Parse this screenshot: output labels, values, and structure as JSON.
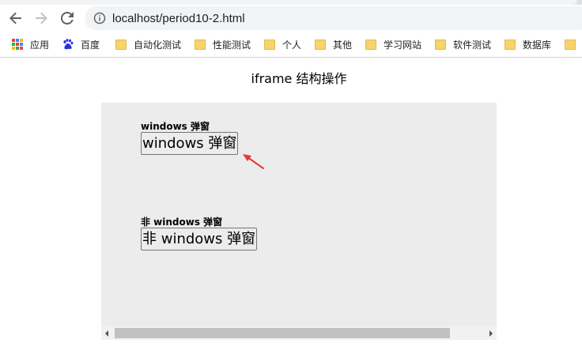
{
  "browser": {
    "url": "localhost/period10-2.html",
    "icons": {
      "back": "arrow-left-icon",
      "forward": "arrow-right-icon",
      "reload": "reload-icon",
      "info": "info-circle-icon"
    }
  },
  "bookmarks": [
    {
      "label": "应用",
      "icon": "apps-grid-icon"
    },
    {
      "label": "百度",
      "icon": "baidu-paw-icon"
    },
    {
      "label": "自动化测试",
      "icon": "folder-icon"
    },
    {
      "label": "性能测试",
      "icon": "folder-icon"
    },
    {
      "label": "个人",
      "icon": "folder-icon"
    },
    {
      "label": "其他",
      "icon": "folder-icon"
    },
    {
      "label": "学习网站",
      "icon": "folder-icon"
    },
    {
      "label": "软件测试",
      "icon": "folder-icon"
    },
    {
      "label": "数据库",
      "icon": "folder-icon"
    }
  ],
  "page": {
    "title": "iframe 结构操作",
    "frame": {
      "windows_label": "windows 弹窗",
      "windows_button": "windows 弹窗",
      "non_windows_label": "非 windows 弹窗",
      "non_windows_button": "非 windows 弹窗"
    }
  },
  "colors": {
    "annotation_arrow": "#e53935",
    "folder": "#f7d46b",
    "iframe_bg": "#ececec"
  }
}
